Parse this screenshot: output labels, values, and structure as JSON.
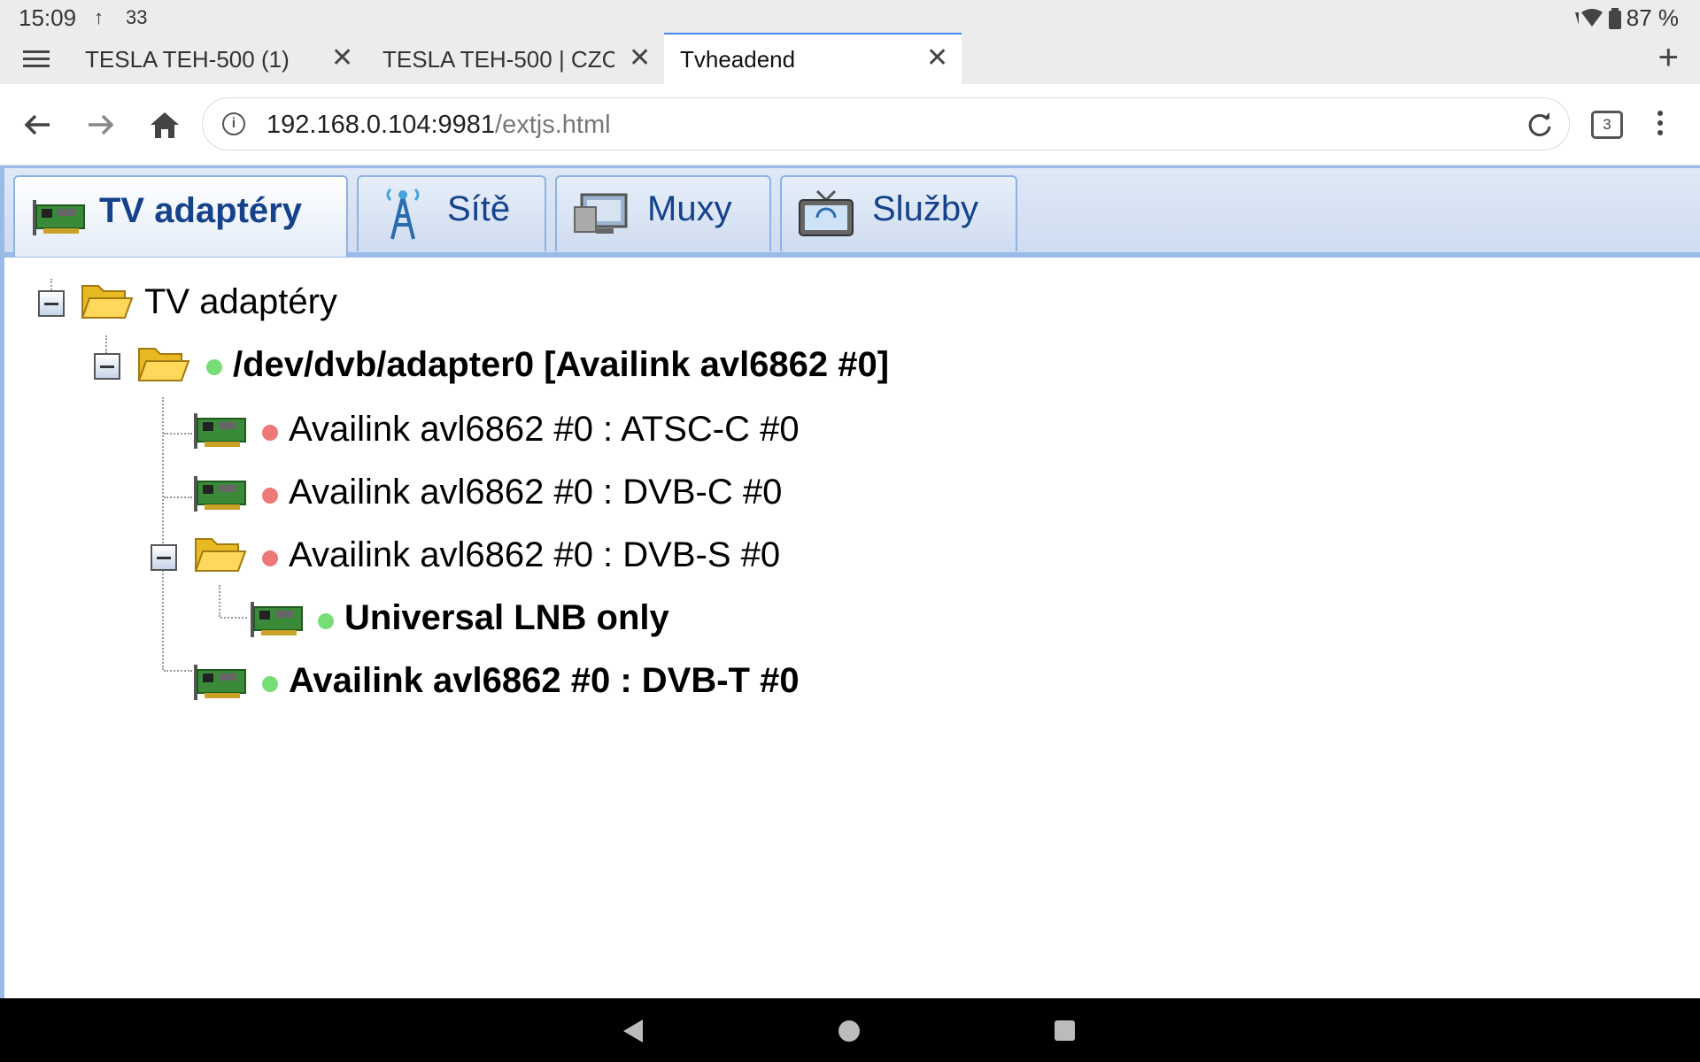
{
  "status_bar": {
    "time": "15:09",
    "signal_text": "↑",
    "notification_count": "33",
    "battery": "87 %"
  },
  "browser_tabs": [
    {
      "title": "TESLA TEH-500 (1)",
      "active": false
    },
    {
      "title": "TESLA TEH-500 | CZC",
      "active": false
    },
    {
      "title": "Tvheadend",
      "active": true
    }
  ],
  "address_bar": {
    "host": "192.168.0.104:9981",
    "path": "/extjs.html",
    "tab_count": "3"
  },
  "app_tabs": [
    {
      "label": "TV adaptéry",
      "icon": "tv-card-icon",
      "active": true
    },
    {
      "label": "Sítě",
      "icon": "antenna-tower-icon",
      "active": false
    },
    {
      "label": "Muxy",
      "icon": "monitor-icon",
      "active": false
    },
    {
      "label": "Služby",
      "icon": "tv-set-icon",
      "active": false
    }
  ],
  "tree": {
    "root": "TV adaptéry",
    "adapter": "/dev/dvb/adapter0 [Availink avl6862 #0]",
    "frontends": [
      {
        "label": "Availink avl6862 #0 : ATSC-C #0",
        "status": "red"
      },
      {
        "label": "Availink avl6862 #0 : DVB-C #0",
        "status": "red"
      },
      {
        "label": "Availink avl6862 #0 : DVB-S #0",
        "status": "red"
      },
      {
        "label": "Universal LNB only",
        "status": "green"
      },
      {
        "label": "Availink avl6862 #0 : DVB-T #0",
        "status": "green"
      }
    ]
  },
  "colors": {
    "status_green": "#77dd77",
    "status_red": "#ee7777",
    "tab_text": "#15428b",
    "panel_border": "#99bbe8"
  }
}
